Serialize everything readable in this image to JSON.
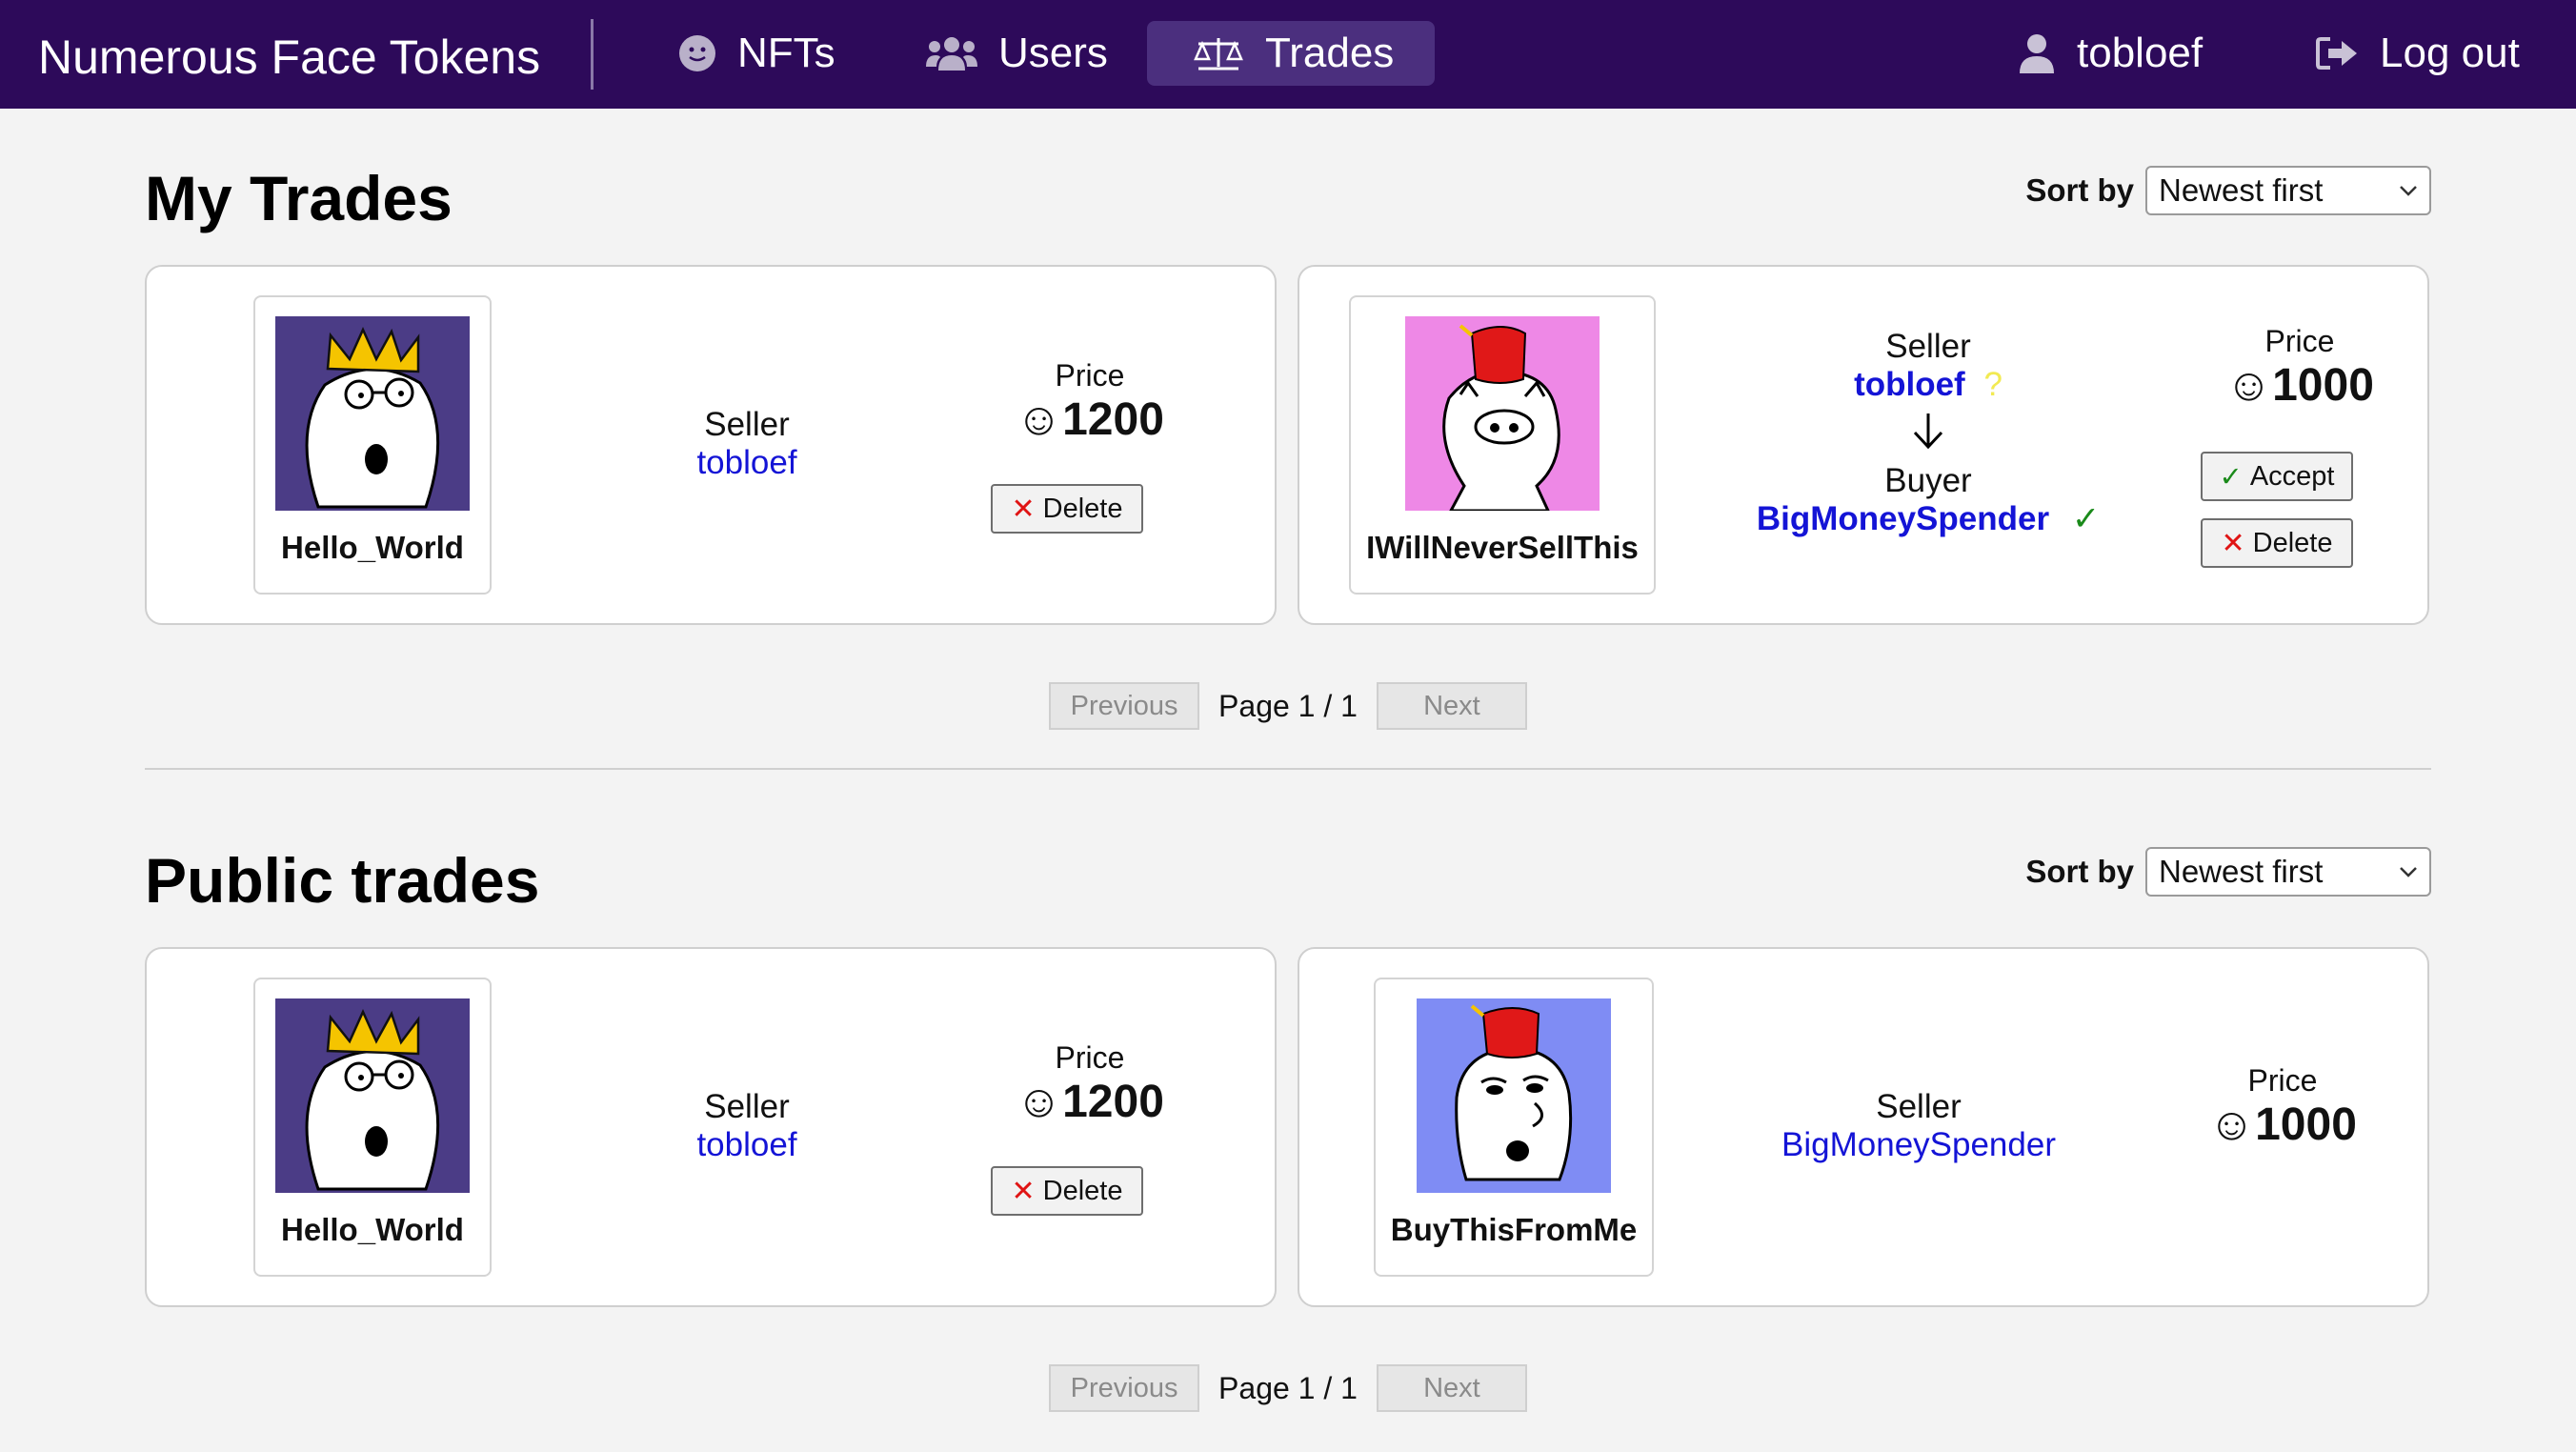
{
  "nav": {
    "brand": "Numerous Face Tokens",
    "items": [
      {
        "label": "NFTs",
        "icon": "smiley-icon"
      },
      {
        "label": "Users",
        "icon": "users-icon"
      },
      {
        "label": "Trades",
        "icon": "scales-icon",
        "active": true
      }
    ],
    "user": "tobloef",
    "logout": "Log out"
  },
  "my_trades": {
    "title": "My Trades",
    "sort_label": "Sort by",
    "sort_value": "Newest first",
    "cards": [
      {
        "nft": "Hello_World",
        "seller_label": "Seller",
        "seller": "tobloef",
        "price_label": "Price",
        "price": "☺1200",
        "delete": "Delete"
      },
      {
        "nft": "IWillNeverSellThis",
        "seller_label": "Seller",
        "seller": "tobloef",
        "seller_status": "?",
        "buyer_label": "Buyer",
        "buyer": "BigMoneySpender",
        "buyer_status": "✓",
        "price_label": "Price",
        "price": "☺1000",
        "accept": "Accept",
        "delete": "Delete"
      }
    ],
    "pager": {
      "prev": "Previous",
      "page": "Page 1 / 1",
      "next": "Next"
    }
  },
  "public_trades": {
    "title": "Public trades",
    "sort_label": "Sort by",
    "sort_value": "Newest first",
    "cards": [
      {
        "nft": "Hello_World",
        "seller_label": "Seller",
        "seller": "tobloef",
        "price_label": "Price",
        "price": "☺1200",
        "delete": "Delete"
      },
      {
        "nft": "BuyThisFromMe",
        "seller_label": "Seller",
        "seller": "BigMoneySpender",
        "price_label": "Price",
        "price": "☺1000"
      }
    ],
    "pager": {
      "prev": "Previous",
      "page": "Page 1 / 1",
      "next": "Next"
    }
  },
  "colors": {
    "nav_bg": "#2d0a5a",
    "link": "#1414d6",
    "hello_world_bg": "#4b3c86",
    "iwill_bg": "#ee88e6",
    "buythis_bg": "#7f8cf4"
  }
}
